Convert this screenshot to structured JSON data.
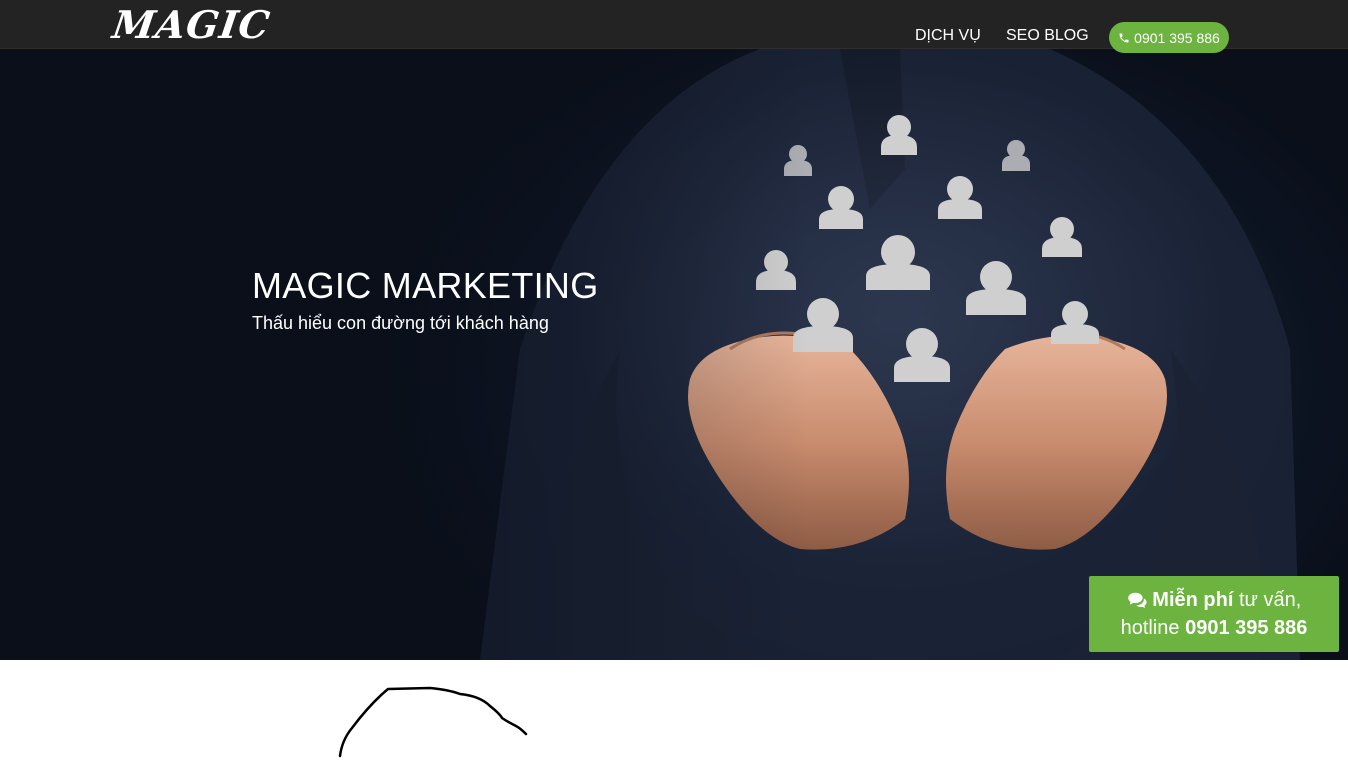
{
  "header": {
    "logo_text": "MAGIC",
    "nav": [
      {
        "label": "DỊCH VỤ"
      },
      {
        "label": "SEO BLOG"
      }
    ],
    "phone_label": "0901 395 886",
    "phone_icon": "phone-icon"
  },
  "hero": {
    "title": "MAGIC MARKETING",
    "subtitle": "Thấu hiểu con đường tới khách hàng"
  },
  "cta": {
    "icon": "chat-icon",
    "bold_text": "Miễn phí",
    "text": " tư vấn,",
    "line2_prefix": "hotline ",
    "line2_number": "0901 395 886"
  },
  "colors": {
    "accent_green": "#6cb33f",
    "navbar_bg": "#232323"
  }
}
